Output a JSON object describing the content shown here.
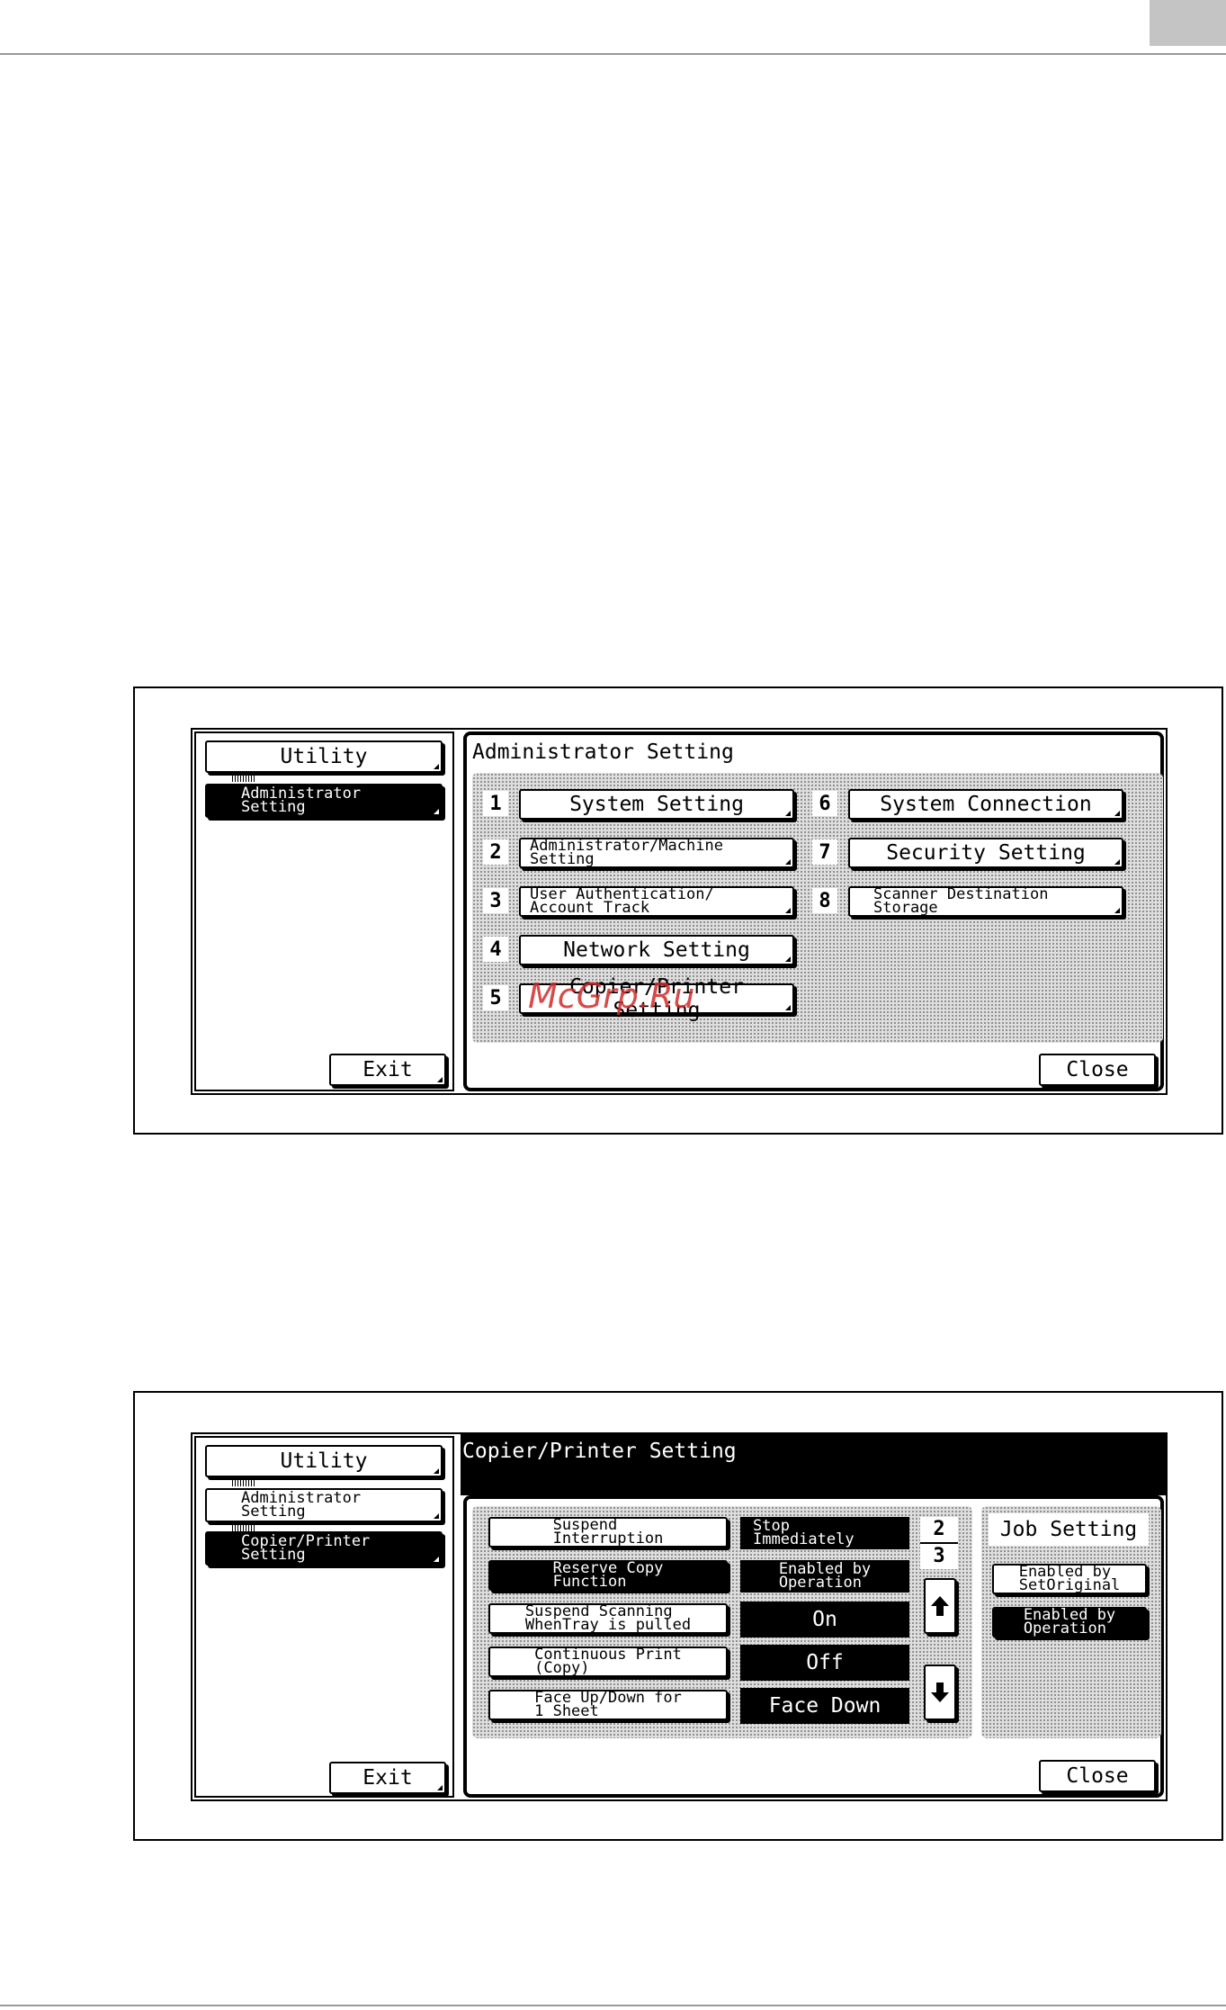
{
  "screen1": {
    "utility_label": "Utility",
    "admin_label": "Administrator\nSetting",
    "exit_label": "Exit",
    "title": "Administrator Setting",
    "close_label": "Close",
    "items": [
      {
        "num": "1",
        "label": "System Setting"
      },
      {
        "num": "2",
        "label": "Administrator/Machine\nSetting"
      },
      {
        "num": "3",
        "label": "User Authentication/\nAccount Track"
      },
      {
        "num": "4",
        "label": "Network Setting"
      },
      {
        "num": "5",
        "label": "Copier/Printer Setting"
      },
      {
        "num": "6",
        "label": "System Connection"
      },
      {
        "num": "7",
        "label": "Security Setting"
      },
      {
        "num": "8",
        "label": "Scanner Destination\nStorage"
      }
    ],
    "watermark": "McGrp.Ru"
  },
  "screen2": {
    "utility_label": "Utility",
    "admin_label": "Administrator\nSetting",
    "copier_label": "Copier/Printer\nSetting",
    "exit_label": "Exit",
    "title": "Copier/Printer Setting",
    "close_label": "Close",
    "rows": [
      {
        "label": "Suspend\nInterruption",
        "value": "Stop\nImmediately"
      },
      {
        "label": "Reserve Copy\nFunction",
        "value": "Enabled by\nOperation"
      },
      {
        "label": "Suspend Scanning\nWhenTray is pulled",
        "value": "On"
      },
      {
        "label": "Continuous Print\n(Copy)",
        "value": "Off"
      },
      {
        "label": "Face Up/Down for\n1 Sheet",
        "value": "Face Down"
      }
    ],
    "page_current": "2",
    "page_total": "3",
    "job_setting_title": "Job Setting",
    "job_opt1": "Enabled by\nSetOriginal",
    "job_opt2": "Enabled by\nOperation"
  }
}
